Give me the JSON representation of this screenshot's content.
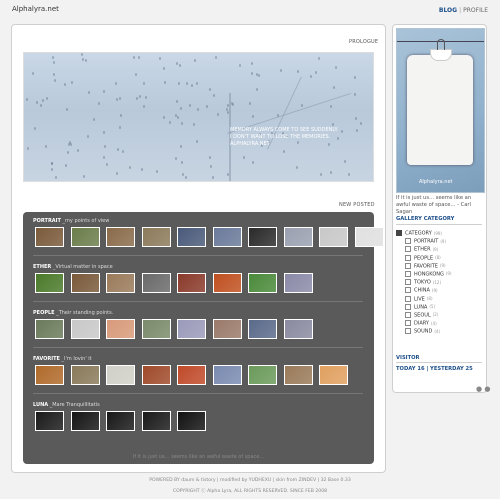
{
  "site": {
    "title": "Alphalyra.net"
  },
  "nav": {
    "items": [
      "BLOG",
      "PROFILE"
    ]
  },
  "main": {
    "prologue_label": "PROLOGUE",
    "hero_lines": [
      "MEMORY ALWAYS COME TO SEE SUDDENLY.",
      "I DON'T WANT TO LOSE THE MEMORIES.",
      "ALPHALYRA.NET"
    ],
    "new_posted_label": "NEW POSTED",
    "footer_quote": "If it is just us... seems like an awful waste of space..."
  },
  "gallery": {
    "categories": [
      {
        "name": "PORTRAIT",
        "sub": "_my points of view",
        "thumbs": [
          "#7a5a3a",
          "#6b7d4a",
          "#8a6b4a",
          "#8c7a5a",
          "#4a5a7a",
          "#6a7a9a",
          "#2a2a2a",
          "#9aa0b0",
          "#c8c8c8",
          "#e0e0e0"
        ]
      },
      {
        "name": "ETHER",
        "sub": "_Virtual matter in space",
        "thumbs": [
          "#4a7a2a",
          "#7a5a3a",
          "#9a7a5a",
          "#6a6a6a",
          "#8a3a2a",
          "#c05020",
          "#4a8a3a",
          "#8a8aa8"
        ]
      },
      {
        "name": "PEOPLE",
        "sub": "_Their standing points.",
        "thumbs": [
          "#6a7a5a",
          "#c8c8c8",
          "#d89a7a",
          "#7a8a6a",
          "#9a9aba",
          "#9a7a6a",
          "#5a6a8a",
          "#8a8aa0"
        ]
      },
      {
        "name": "FAVORITE",
        "sub": "_I'm lovin' it",
        "thumbs": [
          "#b06a2a",
          "#8a7a5a",
          "#d0d0c8",
          "#a04a2a",
          "#c04a2a",
          "#7a8ab0",
          "#6a9a5a",
          "#9a7a5a",
          "#e0a060"
        ]
      },
      {
        "name": "LUNA",
        "sub": "_Mare Tranquillitatis",
        "thumbs": [
          "#1a1a1a",
          "#151515",
          "#181818",
          "#1a1a1a",
          "#121212"
        ]
      }
    ]
  },
  "sidebar": {
    "watermark": "Alphalyra.net",
    "quote": "If it is just us... seems like an awful waste of space... - Carl Sagan",
    "gallery_category_title": "GALLERY CATEGORY",
    "categories": [
      {
        "label": "CATEGORY",
        "count": "(99)"
      },
      {
        "label": "PORTRAIT",
        "count": "(9)"
      },
      {
        "label": "ETHER",
        "count": "(9)"
      },
      {
        "label": "PEOPLE",
        "count": "(8)"
      },
      {
        "label": "FAVORITE",
        "count": "(9)"
      },
      {
        "label": "HONGKONG",
        "count": "(9)"
      },
      {
        "label": "TOKYO",
        "count": "(12)"
      },
      {
        "label": "CHINA",
        "count": "(9)"
      },
      {
        "label": "LIVE",
        "count": "(8)"
      },
      {
        "label": "LUNA",
        "count": "(5)"
      },
      {
        "label": "SEOUL",
        "count": "(2)"
      },
      {
        "label": "DIARY",
        "count": "(4)"
      },
      {
        "label": "SOUND",
        "count": "(4)"
      }
    ],
    "visitor_title": "VISITOR",
    "visitor_text": "TODAY 16 | YESTERDAY 25"
  },
  "credits": {
    "line1": "POWERED BY daum & tistory | modified by YUDHEXU | skin from ZINDEV | 32 Base 0.33",
    "line2": "COPYRIGHT ⓒ Alpha Lyra, ALL RIGHTS RESERVED. SINCE FEB 2008"
  }
}
